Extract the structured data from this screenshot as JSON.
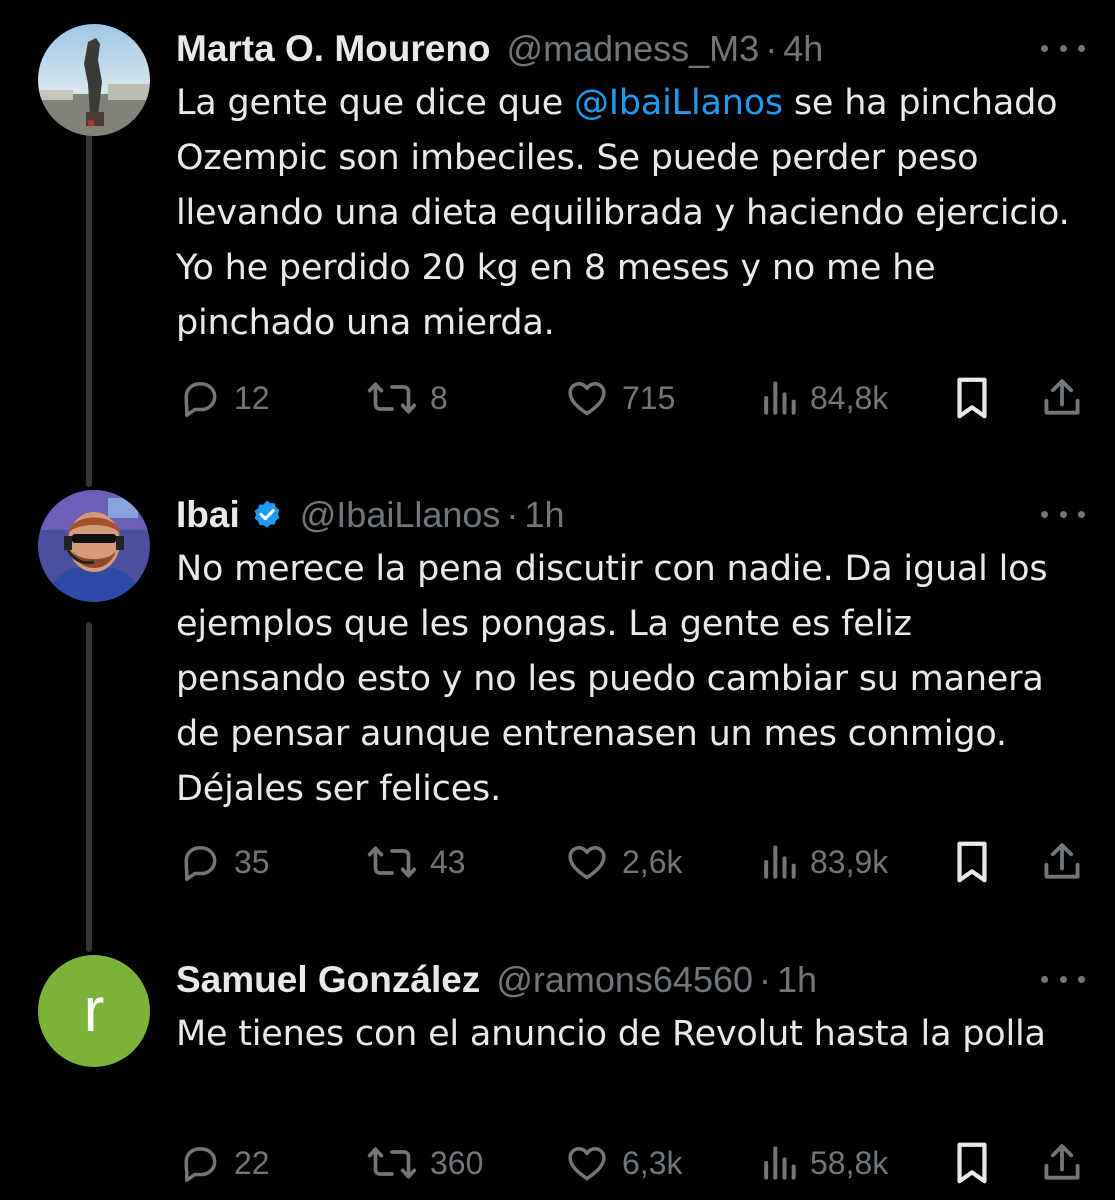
{
  "tweets": [
    {
      "name": "Marta O. Moureno",
      "handle": "@madness_M3",
      "dot": "·",
      "time": "4h",
      "verified": false,
      "avatar_icon": "statue-photo-avatar",
      "text_before": "La gente que dice que ",
      "mention": "@IbaiLlanos",
      "text_after": " se ha pinchado Ozempic son imbeciles. Se puede perder peso llevando una dieta equilibrada y haciendo ejercicio. Yo he perdido 20 kg en 8 meses y no me he pinchado una mierda.",
      "replies": "12",
      "retweets": "8",
      "likes": "715",
      "views": "84,8k"
    },
    {
      "name": "Ibai",
      "handle": "@IbaiLlanos",
      "dot": "·",
      "time": "1h",
      "verified": true,
      "avatar_icon": "streamer-photo-avatar",
      "text_before": "No merece la pena discutir con nadie. Da igual los ejemplos que les pongas. La gente es feliz pensando esto y no les puedo cambiar su manera de pensar aunque entrenasen un mes conmigo. Déjales ser felices.",
      "mention": "",
      "text_after": "",
      "replies": "35",
      "retweets": "43",
      "likes": "2,6k",
      "views": "83,9k"
    },
    {
      "name": "Samuel González",
      "handle": "@ramons64560",
      "dot": "·",
      "time": "1h",
      "verified": false,
      "avatar_letter": "r",
      "text_before": "Me tienes con el anuncio de Revolut hasta la polla",
      "mention": "",
      "text_after": "",
      "replies": "22",
      "retweets": "360",
      "likes": "6,3k",
      "views": "58,8k"
    }
  ],
  "icons": {
    "reply": "reply-icon",
    "retweet": "retweet-icon",
    "like": "heart-icon",
    "views": "views-icon",
    "bookmark": "bookmark-icon",
    "share": "share-icon",
    "more": "more-icon",
    "verified": "verified-badge-icon"
  },
  "colors": {
    "background": "#000000",
    "text": "#e7e9ea",
    "muted": "#71767b",
    "link": "#1d9bf0",
    "thread_line": "#333639",
    "letter_avatar": "#7db33a"
  }
}
